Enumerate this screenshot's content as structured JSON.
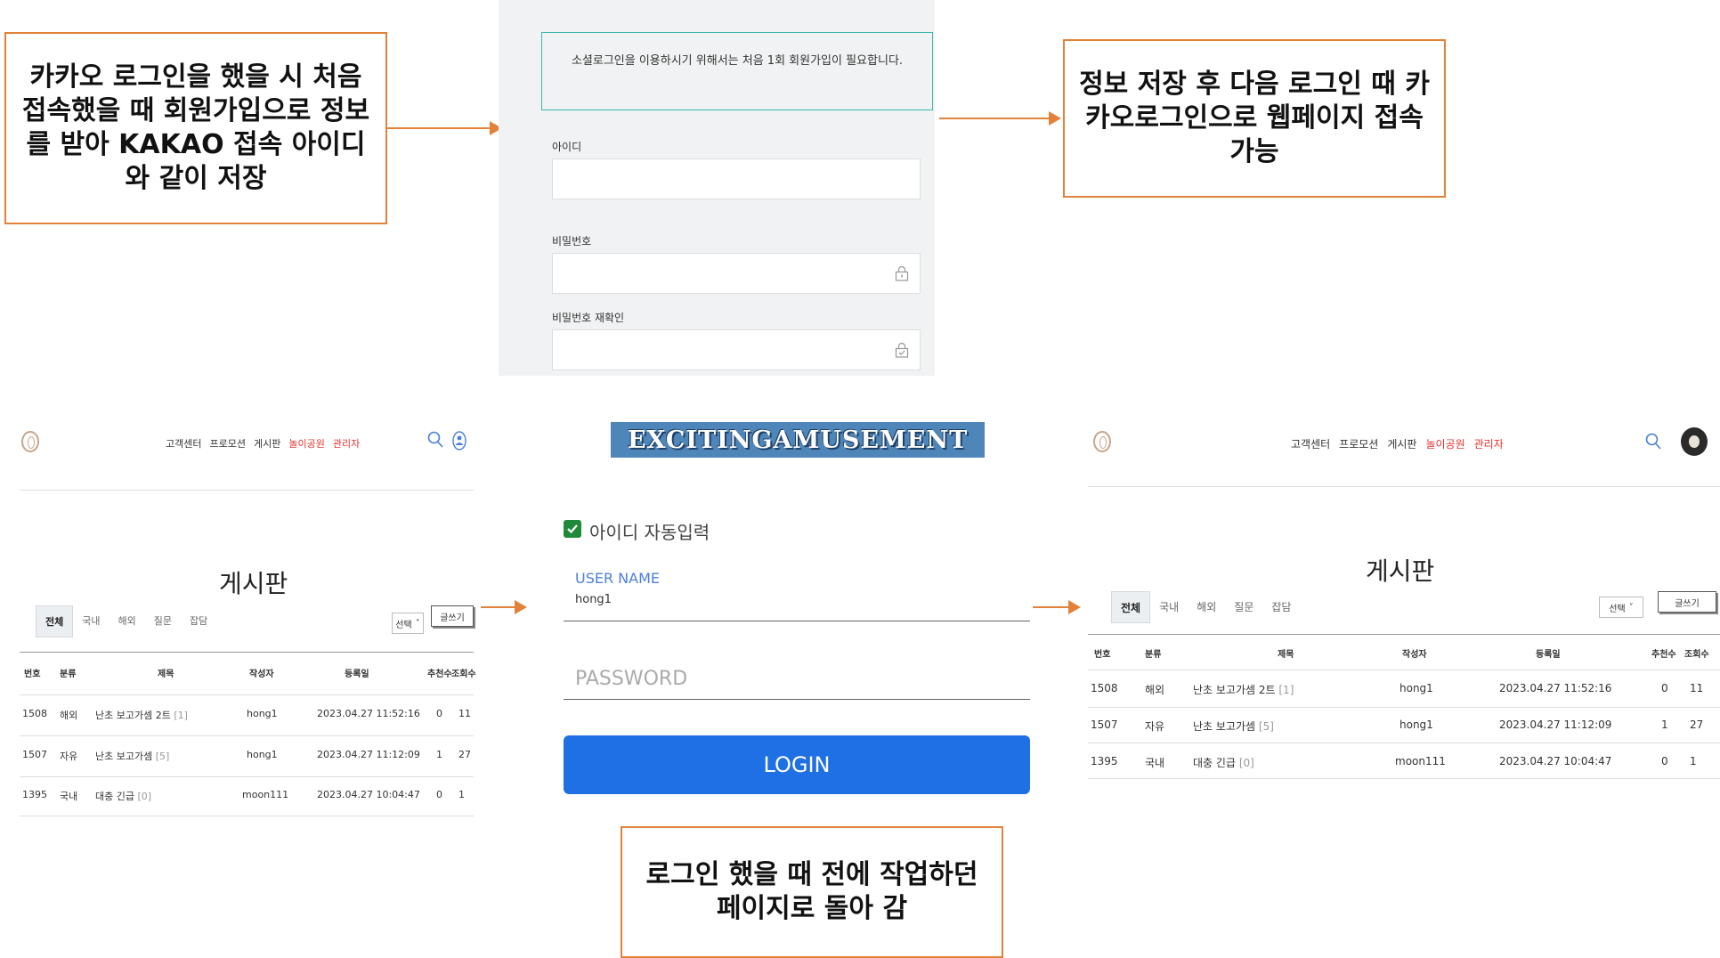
{
  "callouts": {
    "top_left": "카카오 로그인을 했을 시 처음 접속했을 때 회원가입으로 정보를 받아 KAKAO 접속 아이디와 같이 저장",
    "top_right": "정보 저장 후 다음 로그인 때 카카오로그인으로 웹페이지 접속가능",
    "bottom": "로그인 했을 때 전에 작업하던 페이지로 돌아 감"
  },
  "signup": {
    "notice": "소셜로그인을 이용하시기 위해서는 처음 1회 회원가입이 필요합니다.",
    "id_label": "아이디",
    "pw_label": "비밀번호",
    "pw_confirm_label": "비밀번호 재확인"
  },
  "nav": {
    "items": [
      "고객센터",
      "프로모션",
      "게시판",
      "놀이공원",
      "관리자"
    ]
  },
  "board": {
    "title": "게시판",
    "tabs": [
      "전체",
      "국내",
      "해외",
      "질문",
      "잡담"
    ],
    "select_label": "선택",
    "write_label": "글쓰기",
    "headers": [
      "번호",
      "분류",
      "제목",
      "작성자",
      "등록일",
      "추천수",
      "조회수"
    ],
    "rows_left": [
      {
        "no": "1508",
        "cat": "해외",
        "title": "난초 보고가셈 2트",
        "cnt": "[1]",
        "author": "hong1",
        "date": "2023.04.27 11:52:16",
        "rec": "0",
        "views": "11"
      },
      {
        "no": "1507",
        "cat": "자유",
        "title": "난초 보고가셈",
        "cnt": "[5]",
        "author": "hong1",
        "date": "2023.04.27 11:12:09",
        "rec": "1",
        "views": "27"
      },
      {
        "no": "1395",
        "cat": "국내",
        "title": "대충 긴급",
        "cnt": "[0]",
        "author": "moon111",
        "date": "2023.04.27 10:04:47",
        "rec": "0",
        "views": "1"
      }
    ],
    "rows_right": [
      {
        "no": "1508",
        "cat": "해외",
        "title": "난초 보고가셈 2트",
        "cnt": "[1]",
        "author": "hong1",
        "date": "2023.04.27 11:52:16",
        "rec": "0",
        "views": "11"
      },
      {
        "no": "1507",
        "cat": "자유",
        "title": "난초 보고가셈",
        "cnt": "[5]",
        "author": "hong1",
        "date": "2023.04.27 11:12:09",
        "rec": "1",
        "views": "27"
      },
      {
        "no": "1395",
        "cat": "국내",
        "title": "대충 긴급",
        "cnt": "[0]",
        "author": "moon111",
        "date": "2023.04.27 10:04:47",
        "rec": "0",
        "views": "1"
      }
    ]
  },
  "login": {
    "logo_text": "EXCITINGAMUSEMENT",
    "auto_id_label": "아이디 자동입력",
    "auto_id_checked": true,
    "username_label": "USER NAME",
    "username_value": "hong1",
    "password_placeholder": "PASSWORD",
    "login_button": "LOGIN"
  },
  "colors": {
    "callout_border": "#e2823a",
    "accent_teal": "#3ab7b0",
    "nav_red": "#e5322d",
    "login_blue": "#1f6fe5",
    "username_label_blue": "#4a7fd9",
    "checkbox_green": "#1f8a3a"
  }
}
